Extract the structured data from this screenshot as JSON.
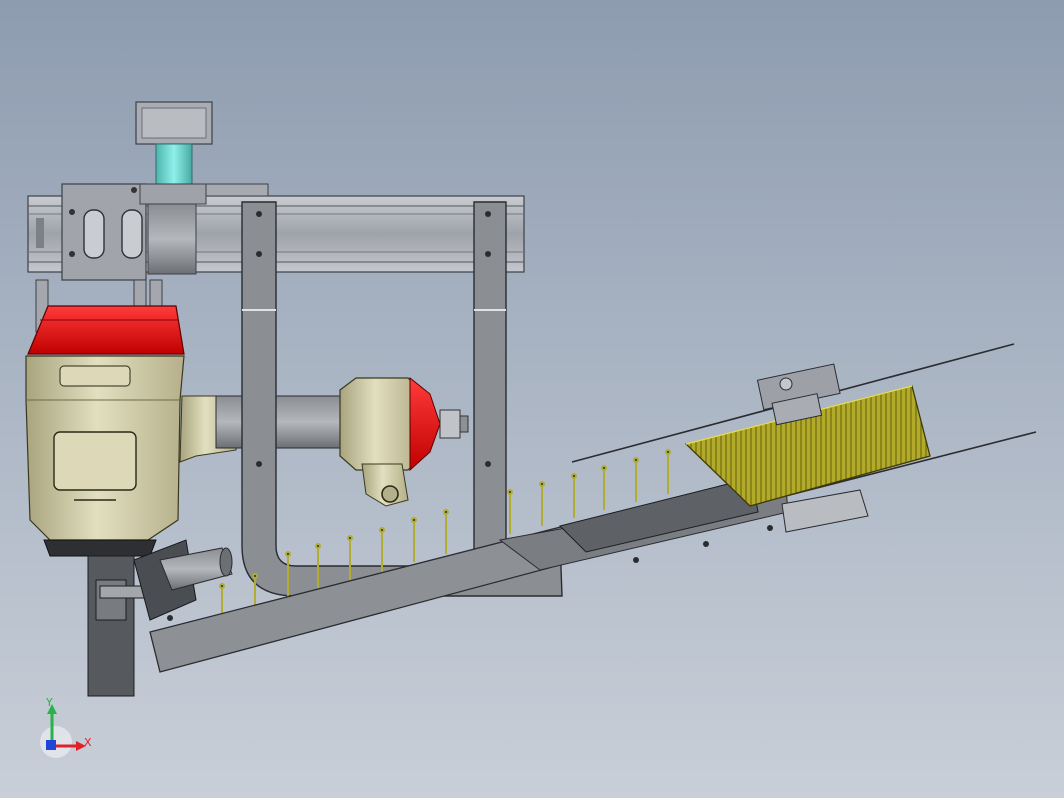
{
  "viewport": {
    "background_top": "#8e9cb0",
    "background_bottom": "#c9cfd8"
  },
  "colors": {
    "body": "#d3cfae",
    "red": "#e01010",
    "yellow_coil": "#c9c03a",
    "steel": "#8a8d92",
    "dark_steel": "#5f6267",
    "cyan": "#6cd1cc",
    "nail": "#b8b23a"
  },
  "triad": {
    "x_label": "X",
    "y_label": "Y",
    "x_color": "#e0202a",
    "y_color": "#28b24a",
    "z_color": "#2046d8"
  }
}
